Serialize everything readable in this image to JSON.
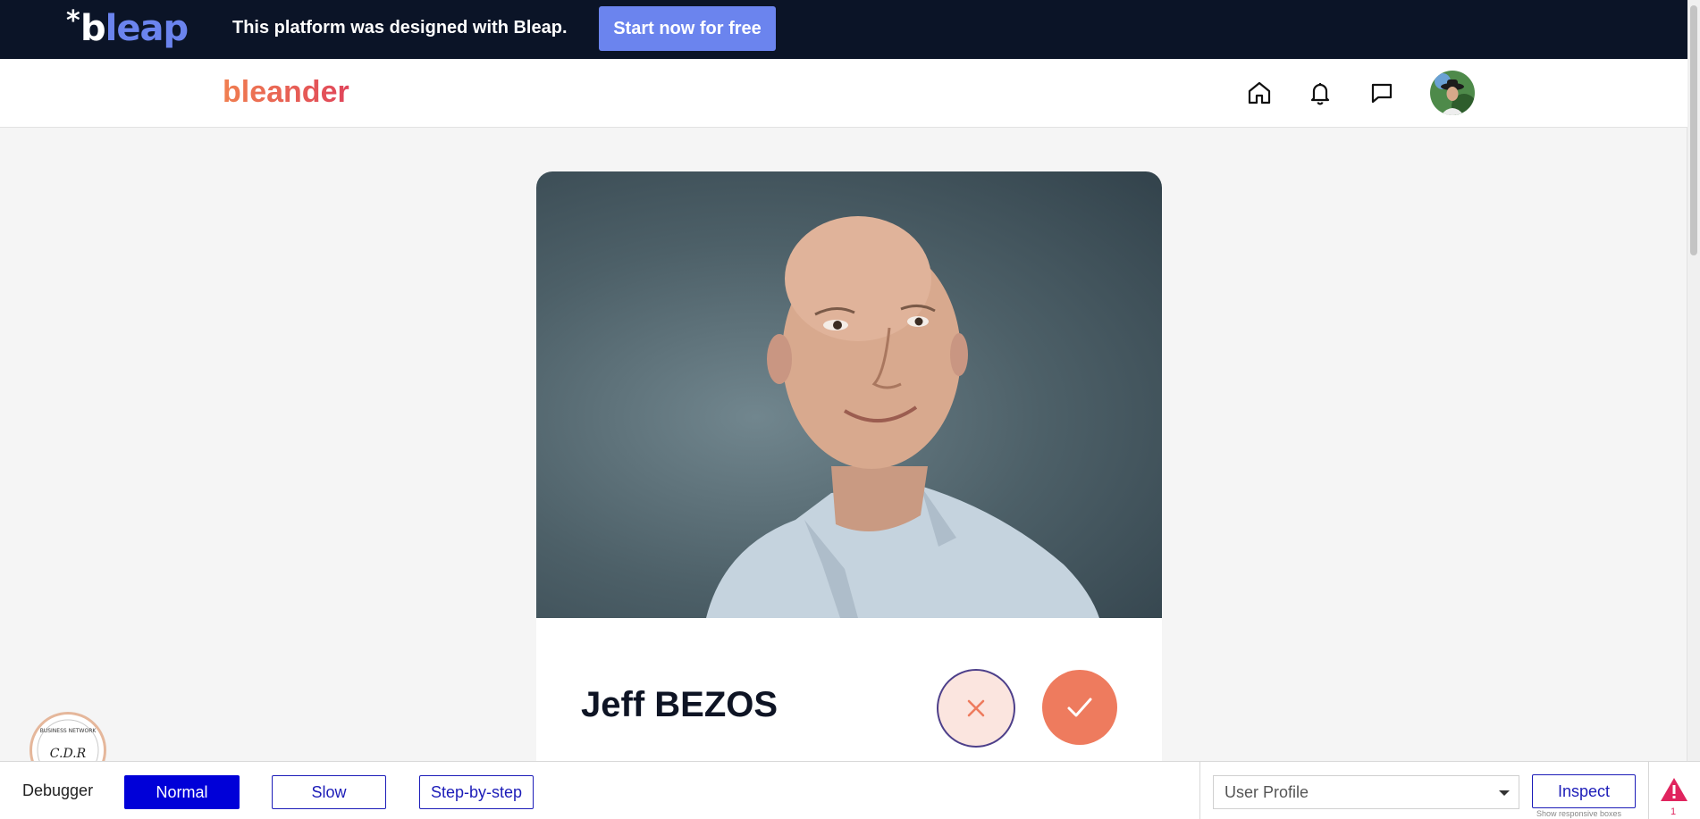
{
  "promo": {
    "logo_star": "*",
    "logo_b": "b",
    "logo_rest": "leap",
    "message": "This platform was designed with Bleap.",
    "cta_label": "Start now for free"
  },
  "header": {
    "brand": "bleander"
  },
  "profile": {
    "name": "Jeff BEZOS"
  },
  "debugger": {
    "label": "Debugger",
    "modes": [
      "Normal",
      "Slow",
      "Step-by-step"
    ],
    "active_mode": "Normal",
    "page_select": "User Profile",
    "inspect_label": "Inspect",
    "inspect_sub": "Show responsive boxes",
    "warning_count": "1"
  },
  "colors": {
    "promo_bg": "#0b1427",
    "bleap_accent": "#6b84ee",
    "brand_gradient_start": "#f07f50",
    "brand_gradient_end": "#e0455a",
    "accept": "#ee7b5e",
    "reject_bg": "#fbe5df",
    "debugger_blue": "#0000d8",
    "warning": "#e0245e"
  }
}
